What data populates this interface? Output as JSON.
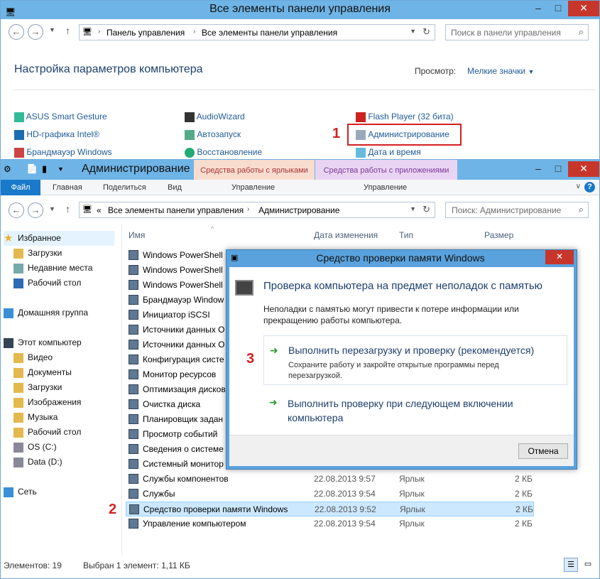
{
  "cp": {
    "title": "Все элементы панели управления",
    "breadcrumb": [
      "Панель управления",
      "Все элементы панели управления"
    ],
    "search_placeholder": "Поиск в панели управления",
    "heading": "Настройка параметров компьютера",
    "view_label": "Просмотр:",
    "view_value": "Мелкие значки",
    "items": {
      "c1": [
        "ASUS Smart Gesture",
        "HD-графика Intel®",
        "Брандмауэр Windows"
      ],
      "c2": [
        "AudioWizard",
        "Автозапуск",
        "Восстановление"
      ],
      "c3": [
        "Flash Player (32 бита)",
        "Администрирование",
        "Дата и время"
      ]
    },
    "mark1": "1"
  },
  "ex": {
    "title": "Администрирование",
    "ctx_tab1": "Средства работы с ярлыками",
    "ctx_tab2": "Средства работы с приложениями",
    "tabs": [
      "Файл",
      "Главная",
      "Поделиться",
      "Вид",
      "Управление",
      "Управление"
    ],
    "breadcrumb": [
      "«",
      "Все элементы панели управления",
      "Администрирование"
    ],
    "search_placeholder": "Поиск: Администрирование",
    "columns": [
      "Имя",
      "Дата изменения",
      "Тип",
      "Размер"
    ],
    "nav": [
      {
        "label": "Избранное",
        "icon": "star-icon"
      },
      {
        "label": "Загрузки",
        "icon": "folder-icon"
      },
      {
        "label": "Недавние места",
        "icon": "recent-icon"
      },
      {
        "label": "Рабочий стол",
        "icon": "desktop-icon"
      },
      {
        "label": "Домашняя группа",
        "icon": "homegroup-icon"
      },
      {
        "label": "Этот компьютер",
        "icon": "computer-icon"
      },
      {
        "label": "Видео",
        "icon": "folder-icon"
      },
      {
        "label": "Документы",
        "icon": "folder-icon"
      },
      {
        "label": "Загрузки",
        "icon": "folder-icon"
      },
      {
        "label": "Изображения",
        "icon": "folder-icon"
      },
      {
        "label": "Музыка",
        "icon": "folder-icon"
      },
      {
        "label": "Рабочий стол",
        "icon": "folder-icon"
      },
      {
        "label": "OS (C:)",
        "icon": "drive-icon"
      },
      {
        "label": "Data (D:)",
        "icon": "drive-icon"
      },
      {
        "label": "Сеть",
        "icon": "network-icon"
      }
    ],
    "files": [
      {
        "name": "Windows PowerShell",
        "date": "",
        "type": "",
        "size": ""
      },
      {
        "name": "Windows PowerShell",
        "date": "",
        "type": "",
        "size": ""
      },
      {
        "name": "Windows PowerShell",
        "date": "",
        "type": "",
        "size": ""
      },
      {
        "name": "Брандмауэр Window",
        "date": "",
        "type": "",
        "size": ""
      },
      {
        "name": "Инициатор iSCSI",
        "date": "",
        "type": "",
        "size": ""
      },
      {
        "name": "Источники данных O",
        "date": "",
        "type": "",
        "size": ""
      },
      {
        "name": "Источники данных O",
        "date": "",
        "type": "",
        "size": ""
      },
      {
        "name": "Конфигурация систе",
        "date": "",
        "type": "",
        "size": ""
      },
      {
        "name": "Монитор ресурсов",
        "date": "",
        "type": "",
        "size": ""
      },
      {
        "name": "Оптимизация дисков",
        "date": "",
        "type": "",
        "size": ""
      },
      {
        "name": "Очистка диска",
        "date": "",
        "type": "",
        "size": ""
      },
      {
        "name": "Планировщик задан",
        "date": "",
        "type": "",
        "size": ""
      },
      {
        "name": "Просмотр событий",
        "date": "",
        "type": "",
        "size": ""
      },
      {
        "name": "Сведения о системе",
        "date": "",
        "type": "",
        "size": ""
      },
      {
        "name": "Системный монитор",
        "date": "",
        "type": "",
        "size": ""
      },
      {
        "name": "Службы компонентов",
        "date": "22.08.2013 9:57",
        "type": "Ярлык",
        "size": "2 КБ"
      },
      {
        "name": "Службы",
        "date": "22.08.2013 9:54",
        "type": "Ярлык",
        "size": "2 КБ"
      },
      {
        "name": "Средство проверки памяти Windows",
        "date": "22.08.2013 9:52",
        "type": "Ярлык",
        "size": "2 КБ"
      },
      {
        "name": "Управление компьютером",
        "date": "22.08.2013 9:54",
        "type": "Ярлык",
        "size": "2 КБ"
      }
    ],
    "status_count": "Элементов: 19",
    "status_sel": "Выбран 1 элемент: 1,11 КБ",
    "mark2": "2"
  },
  "dlg": {
    "title": "Средство проверки памяти Windows",
    "heading": "Проверка компьютера на предмет неполадок с памятью",
    "desc": "Неполадки с памятью могут привести к потере информации или прекращению работы компьютера.",
    "opt1_title": "Выполнить перезагрузку и проверку (рекомендуется)",
    "opt1_sub": "Сохраните работу и закройте открытые программы перед перезагрузкой.",
    "opt2_title": "Выполнить проверку при следующем включении компьютера",
    "cancel": "Отмена",
    "mark3": "3"
  }
}
